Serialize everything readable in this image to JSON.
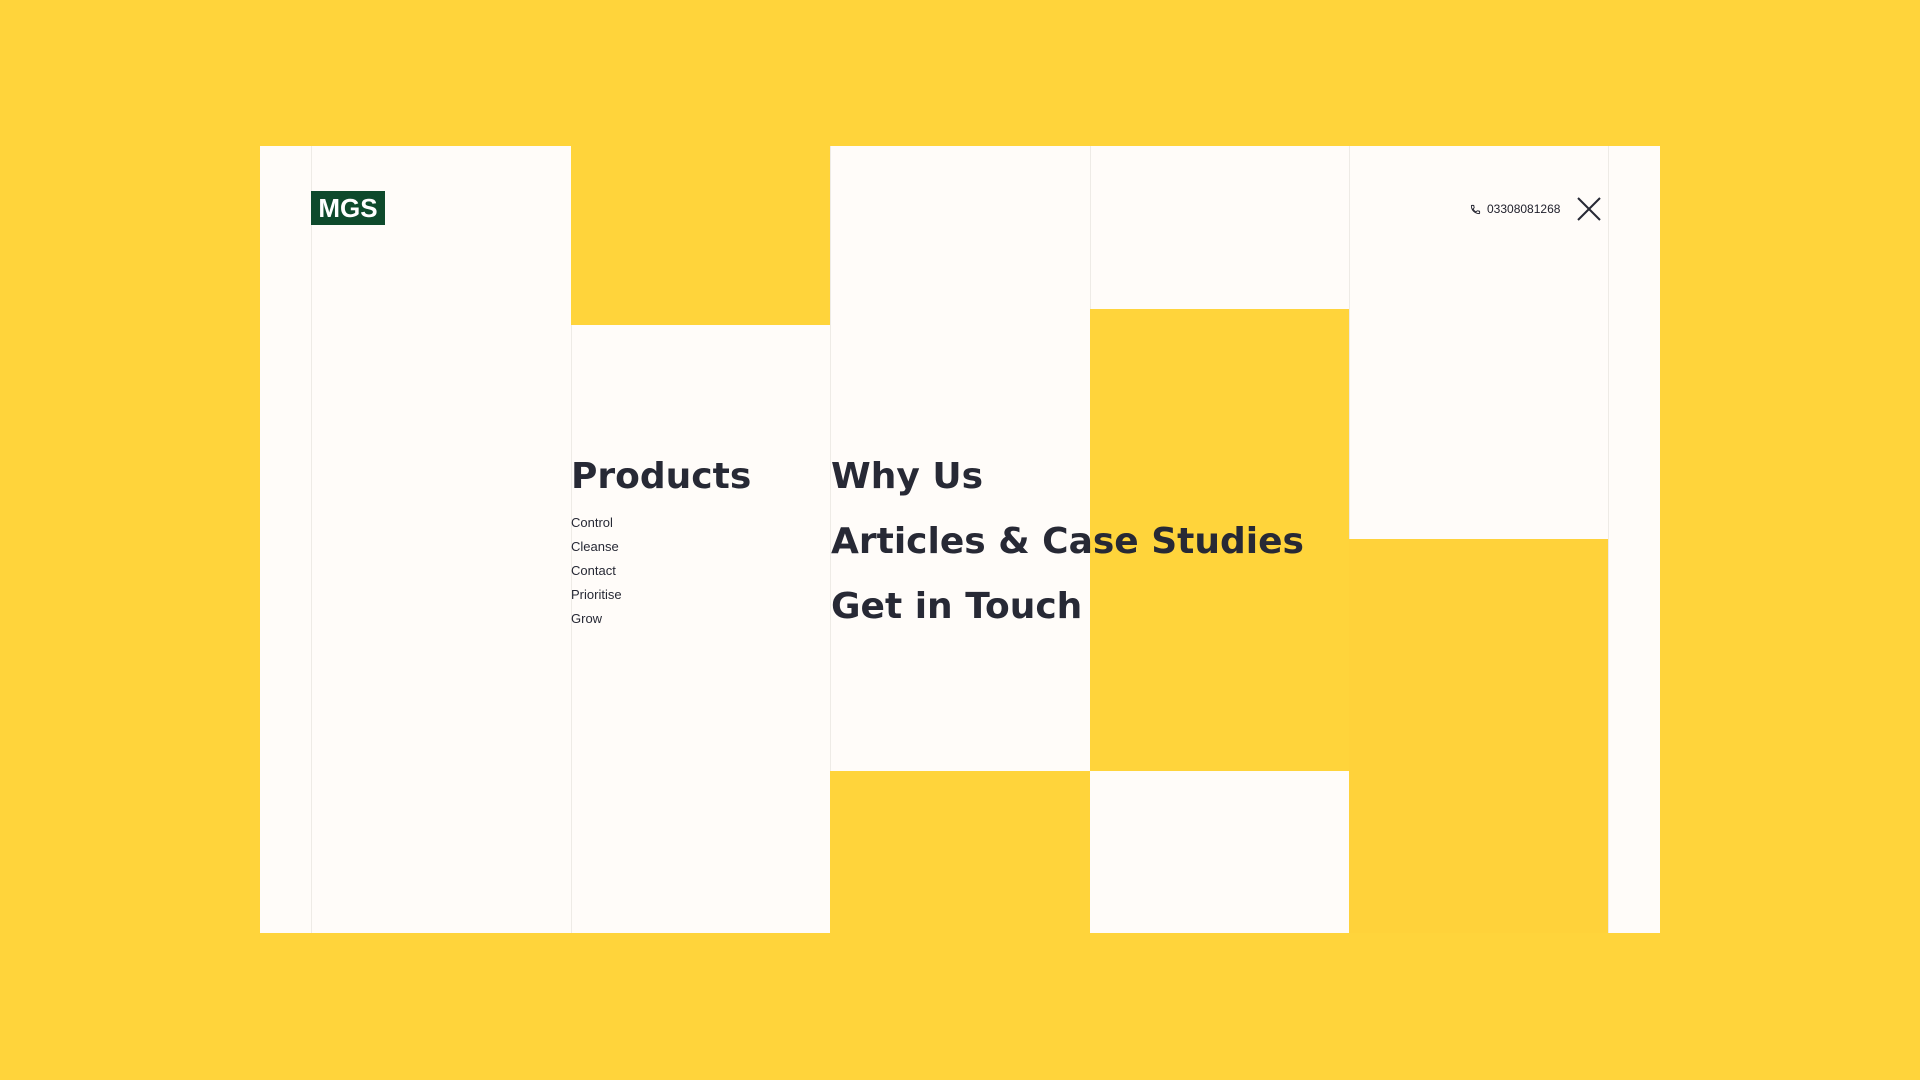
{
  "brand": {
    "logo_text": "MGS",
    "logo_color": "#0E4A2C"
  },
  "header": {
    "phone_number": "03308081268",
    "phone_icon": "phone-icon",
    "close_icon": "close-icon"
  },
  "menu": {
    "products": {
      "label": "Products",
      "items": [
        "Control",
        "Cleanse",
        "Contact",
        "Prioritise",
        "Grow"
      ]
    },
    "links": [
      "Why Us",
      "Articles & Case Studies",
      "Get in Touch"
    ]
  },
  "colors": {
    "accent_yellow": "#FFD43B",
    "panel_white": "#FFFCF9",
    "text_dark": "#272935"
  }
}
